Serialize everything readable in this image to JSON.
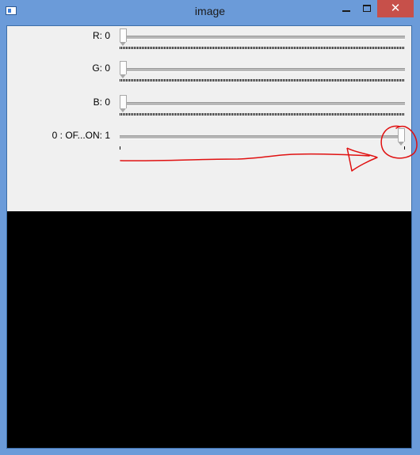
{
  "window": {
    "title": "image",
    "close_glyph": "✕"
  },
  "trackbars": [
    {
      "label": "R: 0",
      "value": 0,
      "max": 255,
      "ticks": "dense"
    },
    {
      "label": "G: 0",
      "value": 0,
      "max": 255,
      "ticks": "dense"
    },
    {
      "label": "B: 0",
      "value": 0,
      "max": 255,
      "ticks": "dense"
    },
    {
      "label": "0 : OF...ON: 1",
      "value": 1,
      "max": 1,
      "ticks": "sparse"
    }
  ],
  "colors": {
    "titlebar": "#6b9bd9",
    "close_button": "#c7504a",
    "panel": "#f0f0f0",
    "image_area": "#000000",
    "annotation": "#e01010"
  },
  "icons": {
    "app": "window-icon",
    "minimize": "minimize-icon",
    "maximize": "maximize-icon",
    "close": "close-icon"
  }
}
